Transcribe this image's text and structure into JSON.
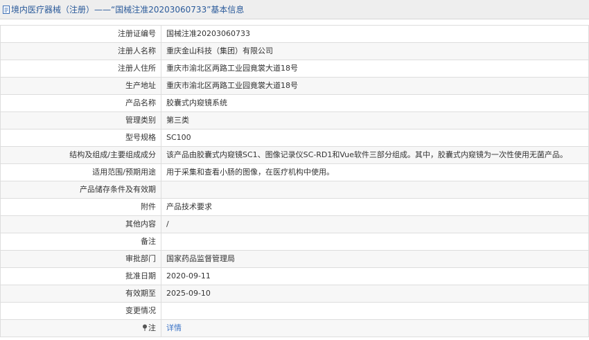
{
  "header": {
    "title": "境内医疗器械（注册）——“国械注准20203060733”基本信息"
  },
  "rows": [
    {
      "label": "注册证编号",
      "value": "国械注准20203060733"
    },
    {
      "label": "注册人名称",
      "value": "重庆金山科技（集团）有限公司"
    },
    {
      "label": "注册人住所",
      "value": "重庆市渝北区两路工业园竟裳大道18号"
    },
    {
      "label": "生产地址",
      "value": "重庆市渝北区两路工业园竟裳大道18号"
    },
    {
      "label": "产品名称",
      "value": "胶囊式内窥镜系统"
    },
    {
      "label": "管理类别",
      "value": "第三类"
    },
    {
      "label": "型号规格",
      "value": "SC100"
    },
    {
      "label": "结构及组成/主要组成成分",
      "value": "该产品由胶囊式内窥镜SC1、图像记录仪SC-RD1和Vue软件三部分组成。其中，胶囊式内窥镜为一次性使用无菌产品。"
    },
    {
      "label": "适用范围/预期用途",
      "value": "用于采集和查看小肠的图像，在医疗机构中使用。"
    },
    {
      "label": "产品储存条件及有效期",
      "value": ""
    },
    {
      "label": "附件",
      "value": "产品技术要求"
    },
    {
      "label": "其他内容",
      "value": "/"
    },
    {
      "label": "备注",
      "value": ""
    },
    {
      "label": "审批部门",
      "value": "国家药品监督管理局"
    },
    {
      "label": "批准日期",
      "value": "2020-09-11"
    },
    {
      "label": "有效期至",
      "value": "2025-09-10"
    },
    {
      "label": "变更情况",
      "value": ""
    }
  ],
  "note_row": {
    "label": "注",
    "link": "详情"
  },
  "icons": {
    "header": "document-icon",
    "note": "pin-icon"
  },
  "colors": {
    "header_text": "#2a5a9a",
    "link": "#3a73c6",
    "header_bg": "#eeeeee"
  }
}
